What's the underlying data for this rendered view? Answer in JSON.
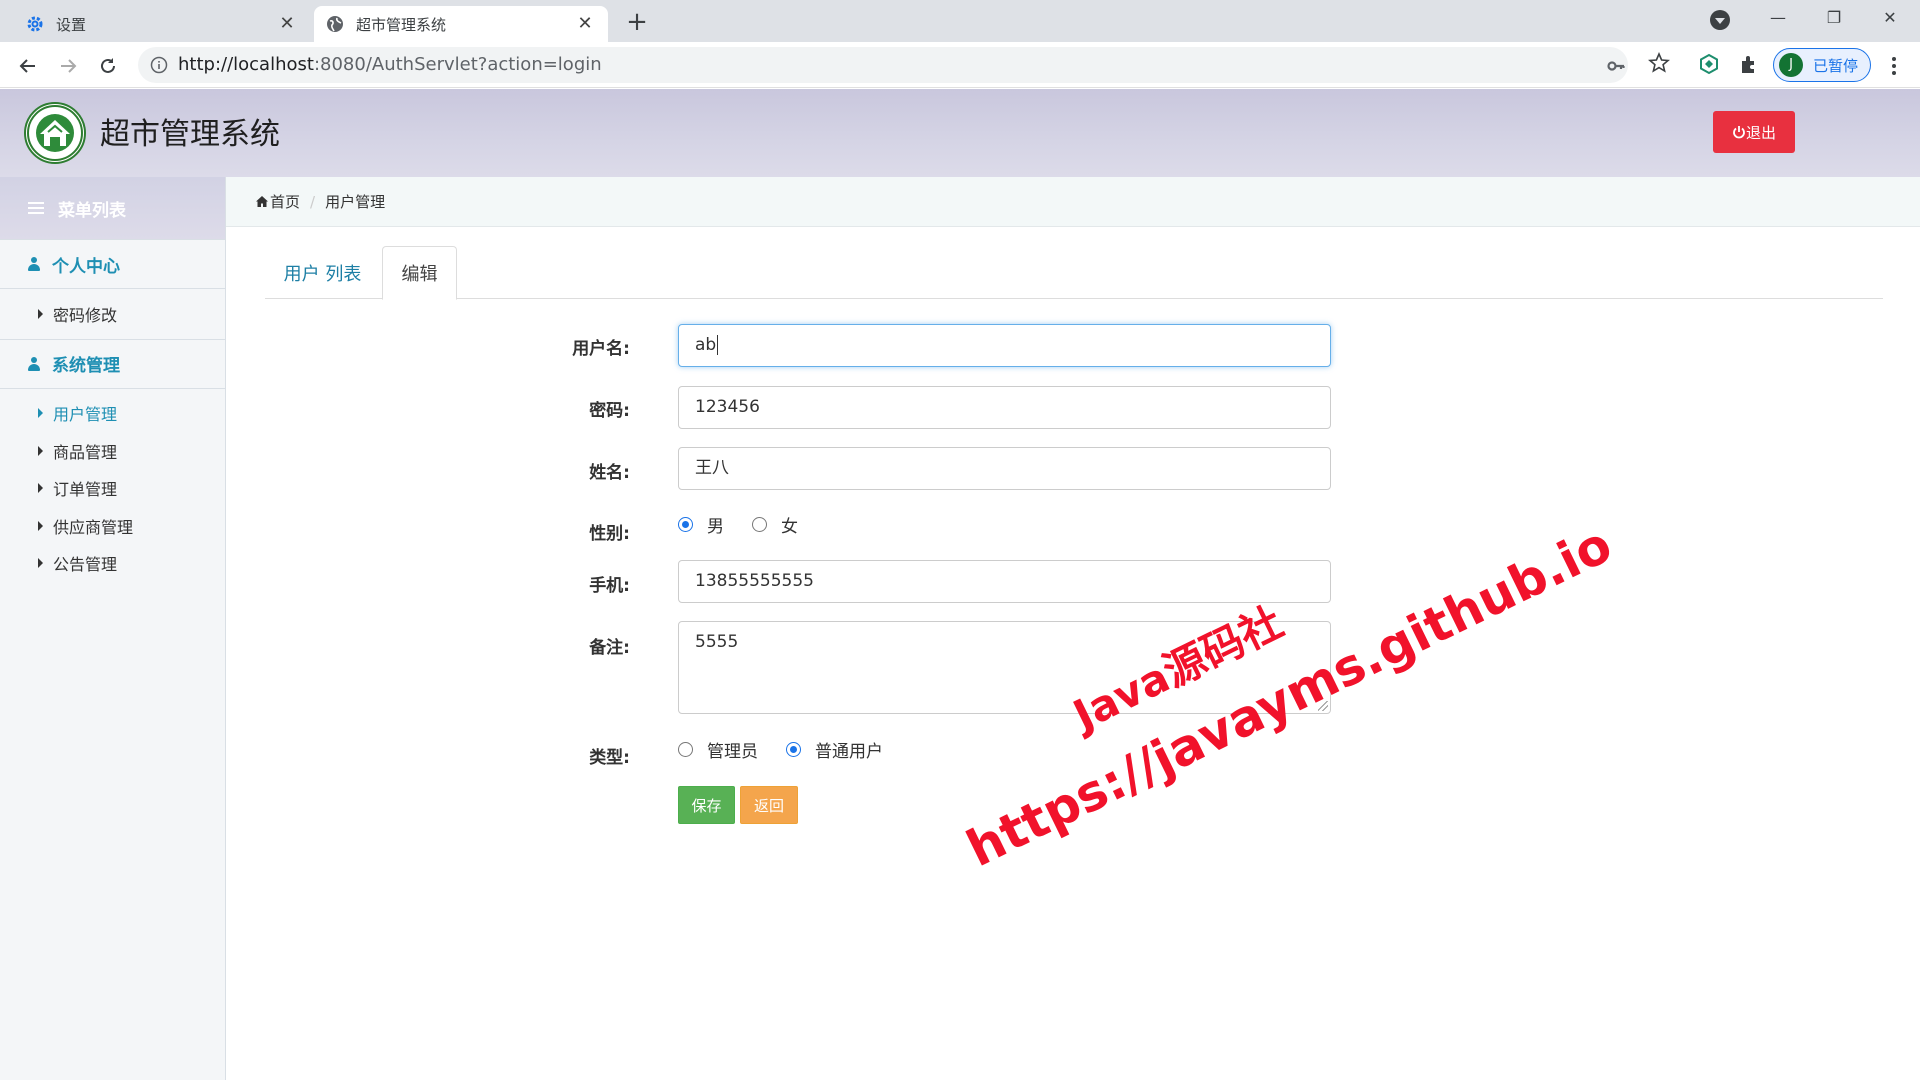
{
  "browser": {
    "tabs": [
      {
        "title": "设置",
        "icon": "gear-icon"
      },
      {
        "title": "超市管理系统",
        "icon": "globe-icon"
      }
    ],
    "url_host": "http://localhost",
    "url_rest": ":8080/AuthServlet?action=login",
    "profile_initial": "J",
    "profile_label": "已暂停"
  },
  "header": {
    "title": "超市管理系统",
    "logout_label": "退出"
  },
  "sidebar": {
    "title": "菜单列表",
    "groups": [
      {
        "label": "个人中心",
        "items": [
          {
            "label": "密码修改"
          }
        ]
      },
      {
        "label": "系统管理",
        "items": [
          {
            "label": "用户管理"
          },
          {
            "label": "商品管理"
          },
          {
            "label": "订单管理"
          },
          {
            "label": "供应商管理"
          },
          {
            "label": "公告管理"
          }
        ]
      }
    ],
    "active_item": "用户管理"
  },
  "breadcrumb": {
    "home": "首页",
    "current": "用户管理"
  },
  "tabs": {
    "list": "用户 列表",
    "edit": "编辑"
  },
  "form": {
    "username_label": "用户名:",
    "username_value": "ab",
    "password_label": "密码:",
    "password_value": "123456",
    "name_label": "姓名:",
    "name_value": "王八",
    "gender_label": "性别:",
    "gender_options": [
      "男",
      "女"
    ],
    "gender_selected": "男",
    "phone_label": "手机:",
    "phone_value": "13855555555",
    "remark_label": "备注:",
    "remark_value": "5555",
    "type_label": "类型:",
    "type_options": [
      "管理员",
      "普通用户"
    ],
    "type_selected": "普通用户",
    "save_label": "保存",
    "back_label": "返回"
  },
  "watermark": {
    "line1": "Java源码社",
    "line2": "https://javayms.github.io"
  },
  "colors": {
    "accent": "#1e8fb3",
    "logout": "#e8303f",
    "save": "#58b155",
    "back": "#f4a54c",
    "watermark": "#f1122b"
  }
}
